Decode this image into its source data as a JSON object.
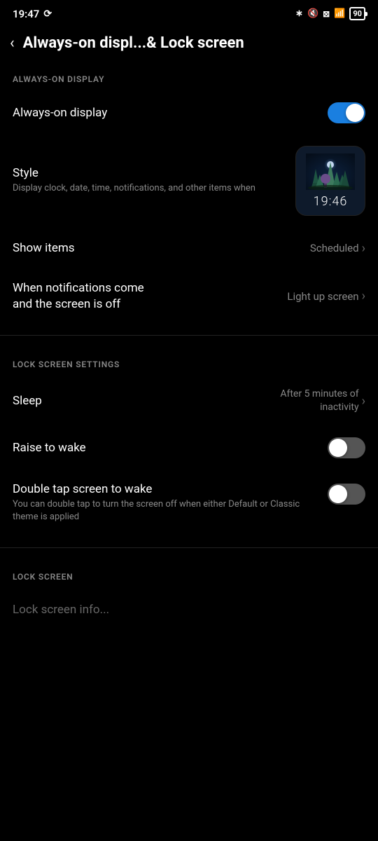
{
  "statusBar": {
    "time": "19:47",
    "battery": "90",
    "icons": [
      "bluetooth",
      "muted",
      "battery-x",
      "wifi",
      "battery"
    ]
  },
  "header": {
    "backLabel": "‹",
    "title": "Always-on displ...& Lock screen"
  },
  "sections": {
    "alwaysOnDisplay": {
      "label": "ALWAYS-ON DISPLAY",
      "rows": [
        {
          "id": "always-on-display",
          "title": "Always-on display",
          "subtitle": "",
          "valueType": "toggle",
          "toggleState": "on"
        },
        {
          "id": "style",
          "title": "Style",
          "subtitle": "Display clock, date, time, notifications, and other items when",
          "valueType": "preview",
          "previewTime": "19:46"
        },
        {
          "id": "show-items",
          "title": "Show items",
          "subtitle": "",
          "valueType": "chevron",
          "value": "Scheduled"
        },
        {
          "id": "notifications-screen-off",
          "title": "When notifications come and the screen is off",
          "subtitle": "",
          "valueType": "chevron",
          "value": "Light up screen"
        }
      ]
    },
    "lockScreenSettings": {
      "label": "LOCK SCREEN SETTINGS",
      "rows": [
        {
          "id": "sleep",
          "title": "Sleep",
          "subtitle": "",
          "valueType": "chevron",
          "value": "After 5 minutes of inactivity"
        },
        {
          "id": "raise-to-wake",
          "title": "Raise to wake",
          "subtitle": "",
          "valueType": "toggle",
          "toggleState": "off"
        },
        {
          "id": "double-tap-wake",
          "title": "Double tap screen to wake",
          "subtitle": "You can double tap to turn the screen off when either Default or Classic theme is applied",
          "valueType": "toggle",
          "toggleState": "off"
        }
      ]
    },
    "lockScreen": {
      "label": "LOCK SCREEN",
      "rows": [
        {
          "id": "lock-screen-info",
          "title": "Lock screen info...",
          "subtitle": "",
          "valueType": "none"
        }
      ]
    }
  }
}
